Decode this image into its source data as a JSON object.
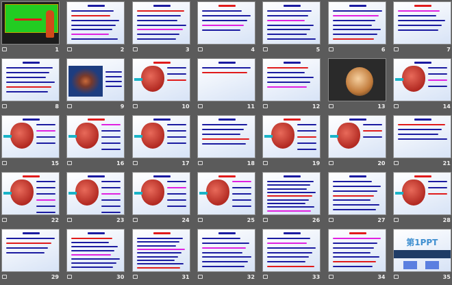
{
  "view": "slide-sorter",
  "colors": {
    "background": "#5b5b5b",
    "text_blue": "#1a1aa0",
    "text_red": "#e01a1a",
    "accent_magenta": "#e020e0"
  },
  "slides": [
    {
      "n": "1",
      "kind": "green"
    },
    {
      "n": "2",
      "kind": "text",
      "lines": 7
    },
    {
      "n": "3",
      "kind": "text",
      "lines": 7
    },
    {
      "n": "4",
      "kind": "text",
      "lines": 5
    },
    {
      "n": "5",
      "kind": "text",
      "lines": 7
    },
    {
      "n": "6",
      "kind": "text",
      "lines": 7
    },
    {
      "n": "7",
      "kind": "text",
      "lines": 5
    },
    {
      "n": "8",
      "kind": "text",
      "lines": 6
    },
    {
      "n": "9",
      "kind": "body"
    },
    {
      "n": "10",
      "kind": "heart",
      "lines": 3
    },
    {
      "n": "11",
      "kind": "text",
      "lines": 2
    },
    {
      "n": "12",
      "kind": "text",
      "lines": 5
    },
    {
      "n": "13",
      "kind": "dark"
    },
    {
      "n": "14",
      "kind": "heart",
      "lines": 4
    },
    {
      "n": "15",
      "kind": "heart",
      "lines": 4
    },
    {
      "n": "16",
      "kind": "heart",
      "lines": 5
    },
    {
      "n": "17",
      "kind": "heart",
      "lines": 4
    },
    {
      "n": "18",
      "kind": "text",
      "lines": 5
    },
    {
      "n": "19",
      "kind": "heart",
      "lines": 5
    },
    {
      "n": "20",
      "kind": "heart",
      "lines": 3
    },
    {
      "n": "21",
      "kind": "text",
      "lines": 4
    },
    {
      "n": "22",
      "kind": "heart",
      "lines": 6
    },
    {
      "n": "23",
      "kind": "heart",
      "lines": 6
    },
    {
      "n": "24",
      "kind": "heart",
      "lines": 5
    },
    {
      "n": "25",
      "kind": "heart",
      "lines": 5
    },
    {
      "n": "26",
      "kind": "text",
      "lines": 9
    },
    {
      "n": "27",
      "kind": "text",
      "lines": 7
    },
    {
      "n": "28",
      "kind": "heart",
      "lines": 3
    },
    {
      "n": "29",
      "kind": "text",
      "lines": 4
    },
    {
      "n": "30",
      "kind": "text",
      "lines": 8
    },
    {
      "n": "31",
      "kind": "text",
      "lines": 9
    },
    {
      "n": "32",
      "kind": "text",
      "lines": 7
    },
    {
      "n": "33",
      "kind": "text",
      "lines": 7
    },
    {
      "n": "34",
      "kind": "text",
      "lines": 7
    },
    {
      "n": "35",
      "kind": "brand",
      "brand": "第1PPT"
    }
  ]
}
